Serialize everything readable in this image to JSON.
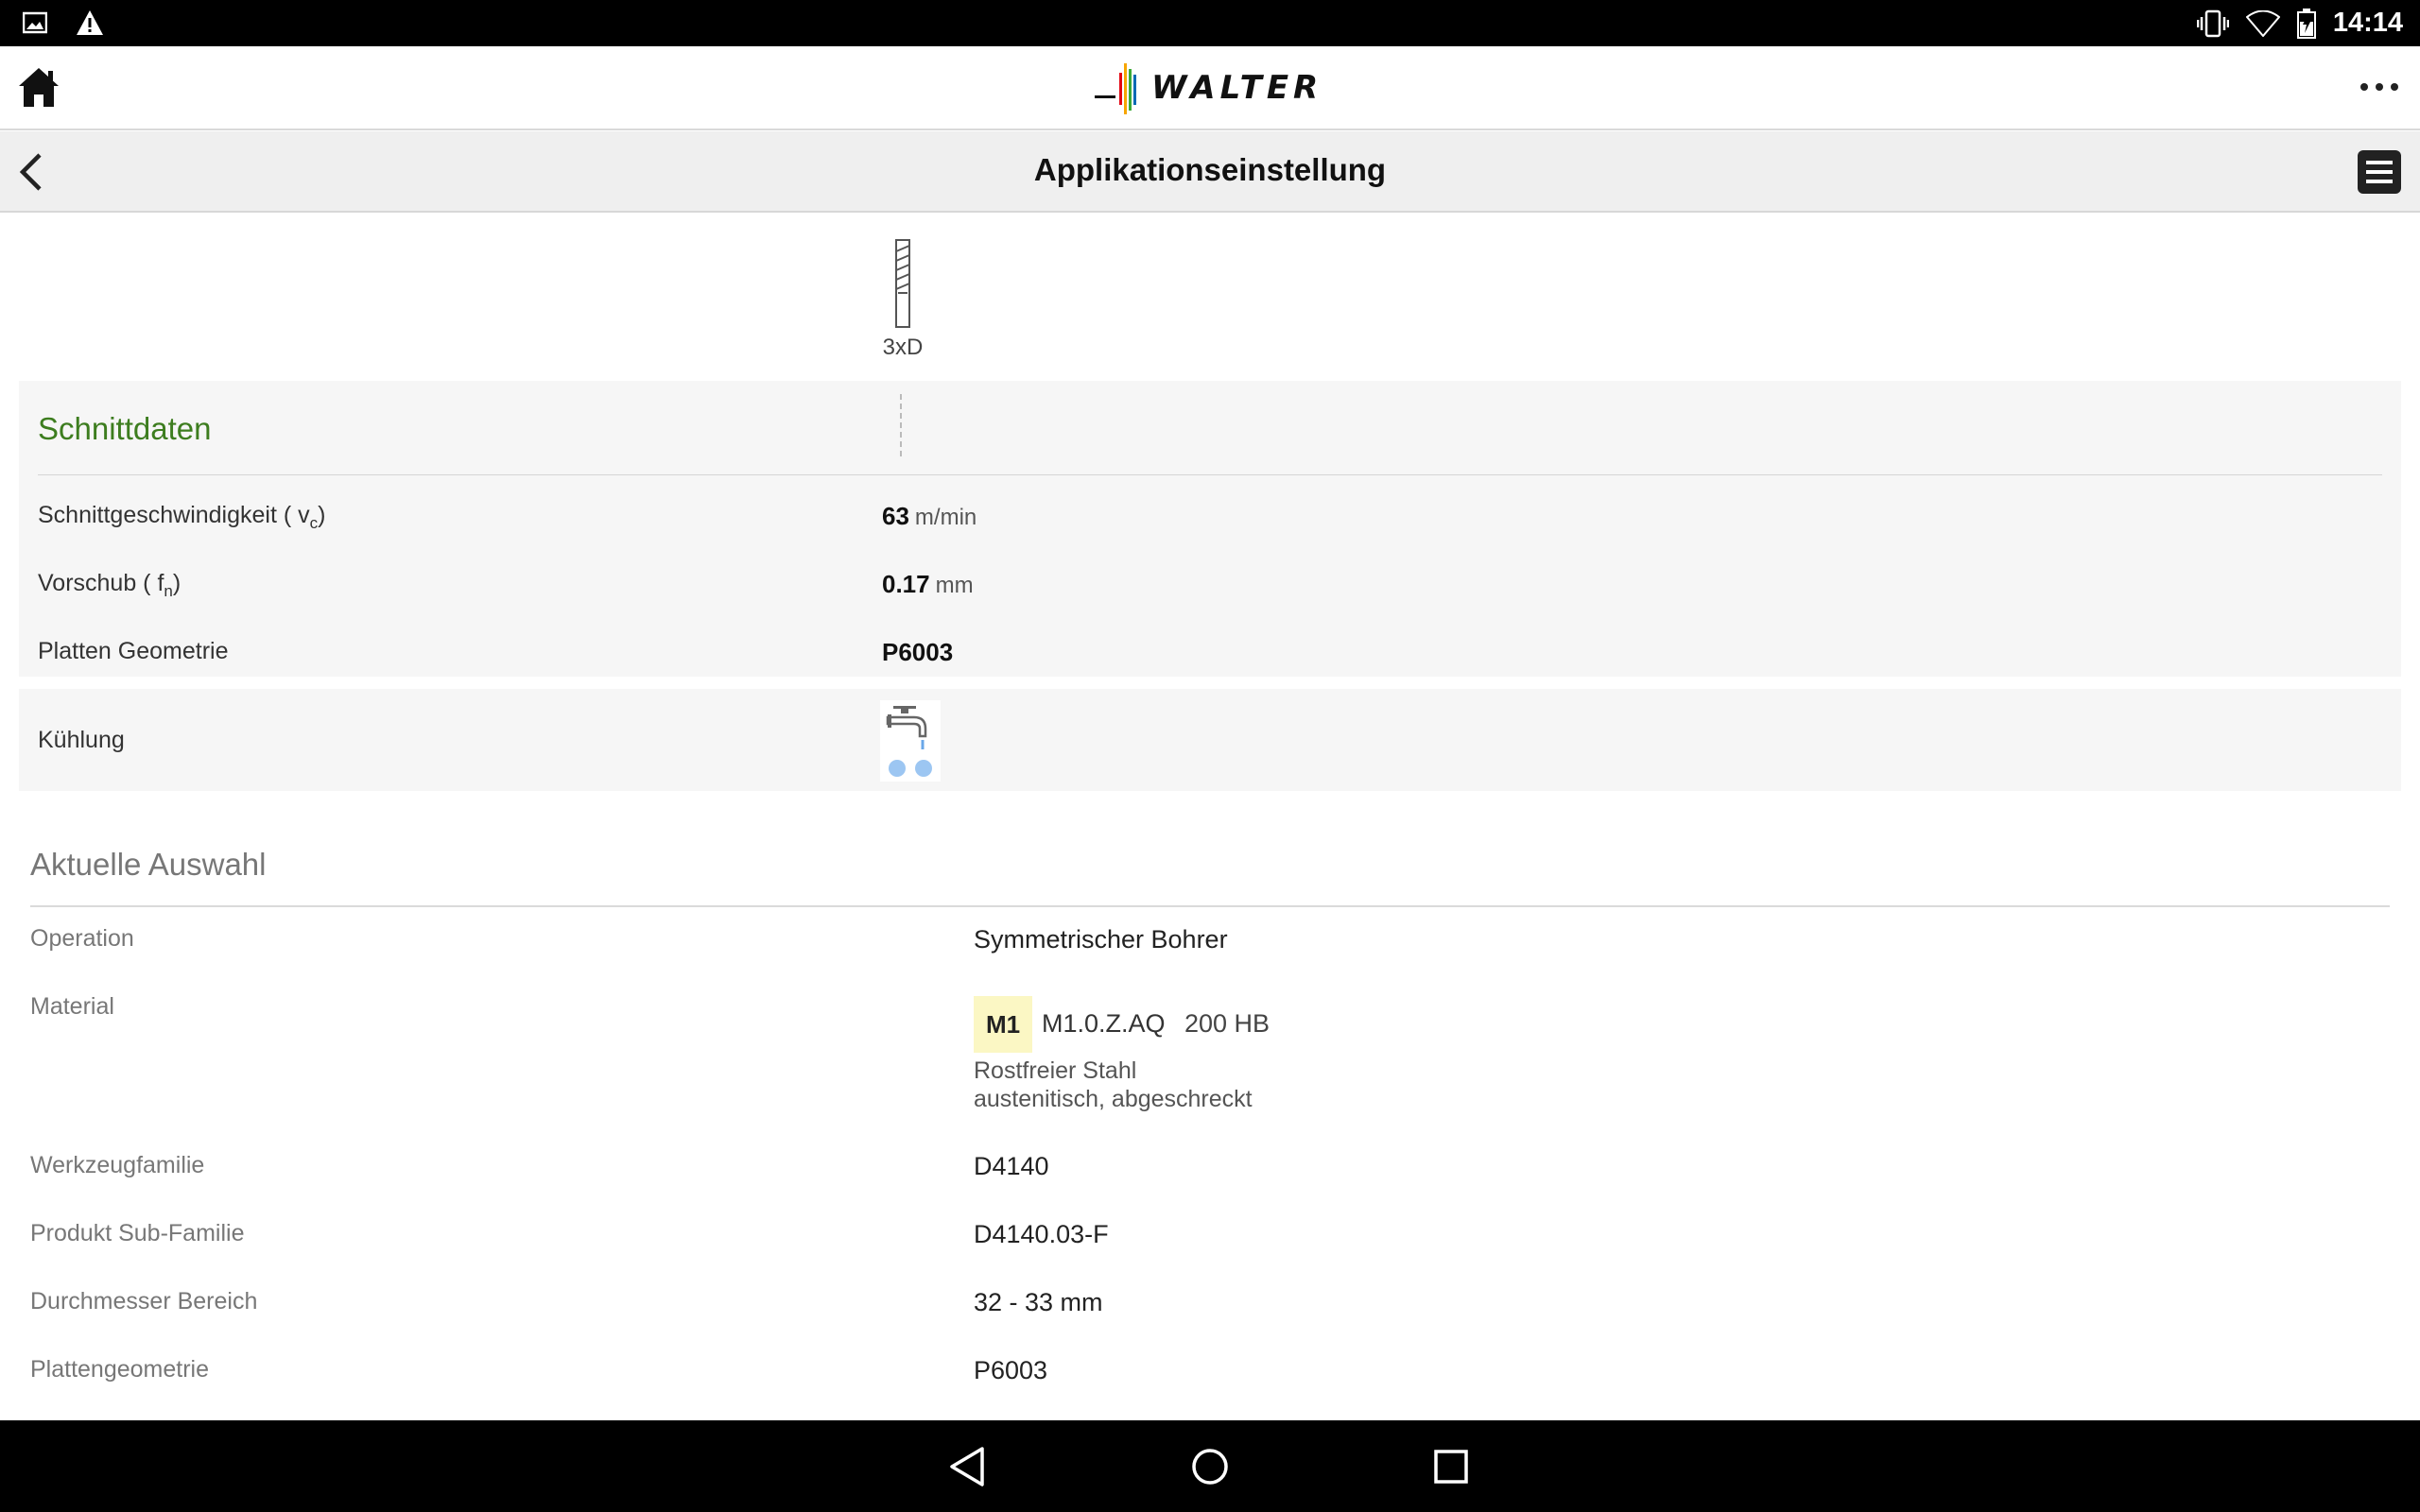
{
  "statusbar": {
    "time": "14:14",
    "left_icons": [
      "image-icon",
      "warning-icon"
    ],
    "right_icons": [
      "vibrate-icon",
      "wifi-icon",
      "battery-charging-icon"
    ]
  },
  "appbar": {
    "brand": "WALTER",
    "brand_colors": [
      "#e30613",
      "#f7a600",
      "#3aaa35",
      "#0069b4"
    ]
  },
  "titlebar": {
    "title": "Applikationseinstellung"
  },
  "tool": {
    "ratio_label": "3xD"
  },
  "cutting_data": {
    "title": "Schnittdaten",
    "rows": [
      {
        "label_pre": "Schnittgeschwindigkeit ( v",
        "label_sub": "c",
        "label_post": ")",
        "value": "63",
        "unit": "m/min"
      },
      {
        "label_pre": "Vorschub ( f",
        "label_sub": "n",
        "label_post": ")",
        "value": "0.17",
        "unit": "mm"
      },
      {
        "label": "Platten Geometrie",
        "value": "P6003"
      }
    ],
    "cooling": {
      "label": "Kühlung",
      "icon": "coolant-tap-icon"
    }
  },
  "selection": {
    "title": "Aktuelle Auswahl",
    "operation": {
      "label": "Operation",
      "value": "Symmetrischer Bohrer"
    },
    "material": {
      "label": "Material",
      "group": "M1",
      "group_color": "#fbf7c4",
      "code": "M1.0.Z.AQ",
      "hardness": "200 HB",
      "desc1": "Rostfreier Stahl",
      "desc2": "austenitisch, abgeschreckt"
    },
    "tool_family": {
      "label": "Werkzeugfamilie",
      "value": "D4140"
    },
    "sub_family": {
      "label": "Produkt Sub-Familie",
      "value": "D4140.03-F"
    },
    "diameter": {
      "label": "Durchmesser Bereich",
      "value": "32 - 33 mm"
    },
    "insert_geometry": {
      "label": "Plattengeometrie",
      "value": "P6003"
    }
  },
  "navbar": {
    "buttons": [
      "back-nav",
      "home-nav",
      "recents-nav"
    ]
  }
}
